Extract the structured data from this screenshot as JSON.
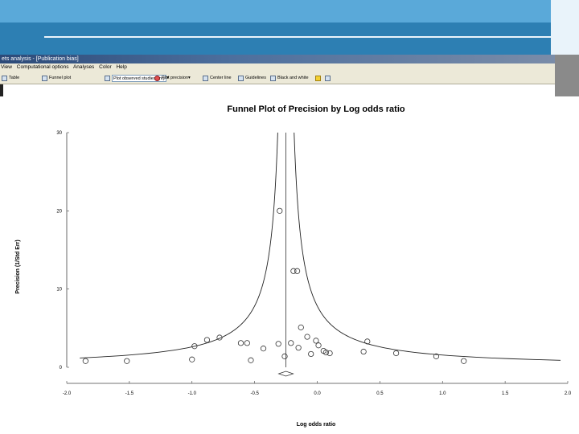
{
  "app": {
    "title": "ets analysis - [Publication bias]",
    "menu": [
      "View",
      "Computational options",
      "Analyses",
      "Color",
      "Help"
    ],
    "toolbar": {
      "table": "Table",
      "funnel_plot": "Funnel plot",
      "observed_studies": "Plot observed studies only",
      "plot_precision": "Plot precision",
      "center_line": "Center line",
      "guidelines": "Guidelines",
      "black_white": "Black and white"
    }
  },
  "colors": {
    "banner_dark": "#2d7fb3",
    "banner_light": "#5aa9d9",
    "app_title_bar": "#2c4a78",
    "toolbar_bg": "#ece9d8"
  },
  "chart_data": {
    "type": "scatter",
    "title": "Funnel Plot of Precision by Log odds ratio",
    "xlabel": "Log odds ratio",
    "ylabel": "Precision (1/Std Err)",
    "xlim": [
      -2.0,
      2.0
    ],
    "ylim": [
      0,
      30
    ],
    "xticks": [
      "-2.0",
      "-1.5",
      "-1.0",
      "-0.5",
      "0.0",
      "0.5",
      "1.0",
      "1.5",
      "2.0"
    ],
    "yticks": [
      "0",
      "10",
      "20",
      "30"
    ],
    "center": -0.25,
    "funnel_constant": 1.96,
    "points": [
      {
        "x": -1.85,
        "y": 0.8
      },
      {
        "x": -1.52,
        "y": 0.8
      },
      {
        "x": -1.0,
        "y": 1.0
      },
      {
        "x": -0.98,
        "y": 2.7
      },
      {
        "x": -0.88,
        "y": 3.5
      },
      {
        "x": -0.78,
        "y": 3.8
      },
      {
        "x": -0.61,
        "y": 3.1
      },
      {
        "x": -0.56,
        "y": 3.1
      },
      {
        "x": -0.53,
        "y": 0.9
      },
      {
        "x": -0.43,
        "y": 2.4
      },
      {
        "x": -0.31,
        "y": 3.0
      },
      {
        "x": -0.3,
        "y": 20.0
      },
      {
        "x": -0.26,
        "y": 1.4
      },
      {
        "x": -0.21,
        "y": 3.1
      },
      {
        "x": -0.19,
        "y": 12.3
      },
      {
        "x": -0.16,
        "y": 12.3
      },
      {
        "x": -0.15,
        "y": 2.5
      },
      {
        "x": -0.13,
        "y": 5.1
      },
      {
        "x": -0.08,
        "y": 3.9
      },
      {
        "x": -0.05,
        "y": 1.7
      },
      {
        "x": -0.01,
        "y": 3.4
      },
      {
        "x": 0.01,
        "y": 2.8
      },
      {
        "x": 0.05,
        "y": 2.1
      },
      {
        "x": 0.07,
        "y": 1.9
      },
      {
        "x": 0.1,
        "y": 1.8
      },
      {
        "x": 0.37,
        "y": 2.0
      },
      {
        "x": 0.4,
        "y": 3.3
      },
      {
        "x": 0.63,
        "y": 1.8
      },
      {
        "x": 0.95,
        "y": 1.4
      },
      {
        "x": 1.17,
        "y": 0.8
      }
    ]
  }
}
